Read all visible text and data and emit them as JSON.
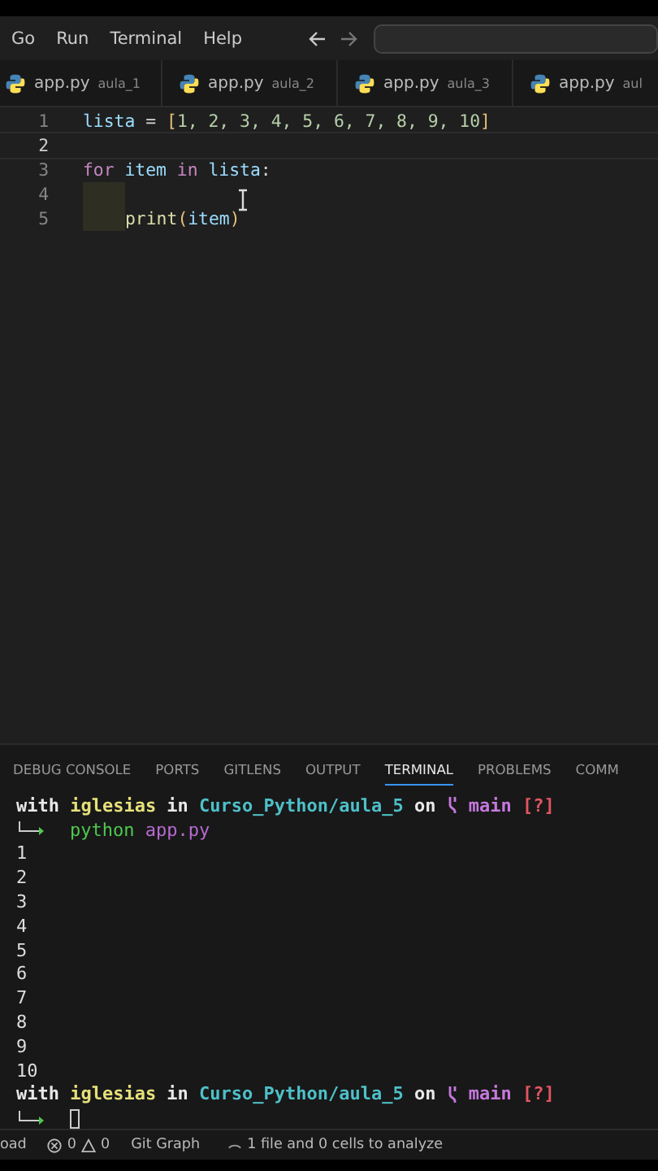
{
  "menu": [
    "Go",
    "Run",
    "Terminal",
    "Help"
  ],
  "tabs": [
    {
      "name": "app.py",
      "folder": "aula_1",
      "selected": false
    },
    {
      "name": "app.py",
      "folder": "aula_2",
      "selected": false
    },
    {
      "name": "app.py",
      "folder": "aula_3",
      "selected": false
    },
    {
      "name": "app.py",
      "folder": "aul",
      "selected": false
    }
  ],
  "code": [
    {
      "number": "1",
      "current": false,
      "indented": false,
      "tokens": [
        {
          "text": "lista",
          "kind": "var"
        },
        {
          "text": " = ",
          "kind": "op"
        },
        {
          "text": "[",
          "kind": "bracket"
        },
        {
          "text": "1, 2, 3, 4, 5, 6, 7, 8, 9, 10",
          "kind": "num"
        },
        {
          "text": "]",
          "kind": "bracket"
        }
      ]
    },
    {
      "number": "2",
      "current": true
    },
    {
      "number": "3",
      "current": false,
      "indented": false,
      "tokens": [
        {
          "text": "for",
          "kind": "keyword"
        },
        {
          "text": " item ",
          "kind": "var"
        },
        {
          "text": "in",
          "kind": "keyword"
        },
        {
          "text": " lista",
          "kind": "var"
        },
        {
          "text": ":",
          "kind": "op"
        }
      ]
    },
    {
      "number": "4",
      "current": false
    },
    {
      "number": "5",
      "current": false,
      "indented": true,
      "tokens": [
        {
          "text": "print",
          "kind": "func"
        },
        {
          "text": "(",
          "kind": "bracket"
        },
        {
          "text": "item",
          "kind": "var"
        },
        {
          "text": ")",
          "kind": "bracket"
        }
      ]
    }
  ],
  "panel_tabs": [
    {
      "label": "DEBUG CONSOLE",
      "selected": false
    },
    {
      "label": "PORTS",
      "selected": false
    },
    {
      "label": "GITLENS",
      "selected": false
    },
    {
      "label": "OUTPUT",
      "selected": false
    },
    {
      "label": "TERMINAL",
      "selected": true
    },
    {
      "label": "PROBLEMS",
      "selected": false
    },
    {
      "label": "COMM",
      "selected": false
    }
  ],
  "terminal": [
    {
      "kind": "prompt",
      "segments": [
        {
          "text": "with",
          "kind": "plain"
        },
        {
          "text": "iglesias",
          "kind": "user"
        },
        {
          "text": "in",
          "kind": "plain"
        },
        {
          "text": "Curso_Python/aula_5",
          "kind": "path"
        },
        {
          "text": "on",
          "kind": "plain"
        },
        {
          "text": "main",
          "kind": "branch"
        },
        {
          "text": "[?]",
          "kind": "status"
        }
      ]
    },
    {
      "kind": "command",
      "program": "python",
      "args": "app.py"
    },
    {
      "kind": "output",
      "text": "1"
    },
    {
      "kind": "output",
      "text": "2"
    },
    {
      "kind": "output",
      "text": "3"
    },
    {
      "kind": "output",
      "text": "4"
    },
    {
      "kind": "output",
      "text": "5"
    },
    {
      "kind": "output",
      "text": "6"
    },
    {
      "kind": "output",
      "text": "7"
    },
    {
      "kind": "output",
      "text": "8"
    },
    {
      "kind": "output",
      "text": "9"
    },
    {
      "kind": "output",
      "text": "10"
    },
    {
      "kind": "prompt",
      "segments": [
        {
          "text": "with",
          "kind": "plain"
        },
        {
          "text": "iglesias",
          "kind": "user"
        },
        {
          "text": "in",
          "kind": "plain"
        },
        {
          "text": "Curso_Python/aula_5",
          "kind": "path"
        },
        {
          "text": "on",
          "kind": "plain"
        },
        {
          "text": "main",
          "kind": "branch"
        },
        {
          "text": "[?]",
          "kind": "status"
        }
      ]
    },
    {
      "kind": "input"
    }
  ],
  "status_bar": {
    "left": "oad",
    "errors": "0",
    "warnings": "0",
    "git": "Git Graph",
    "analysis": "1 file and 0 cells to analyze"
  }
}
